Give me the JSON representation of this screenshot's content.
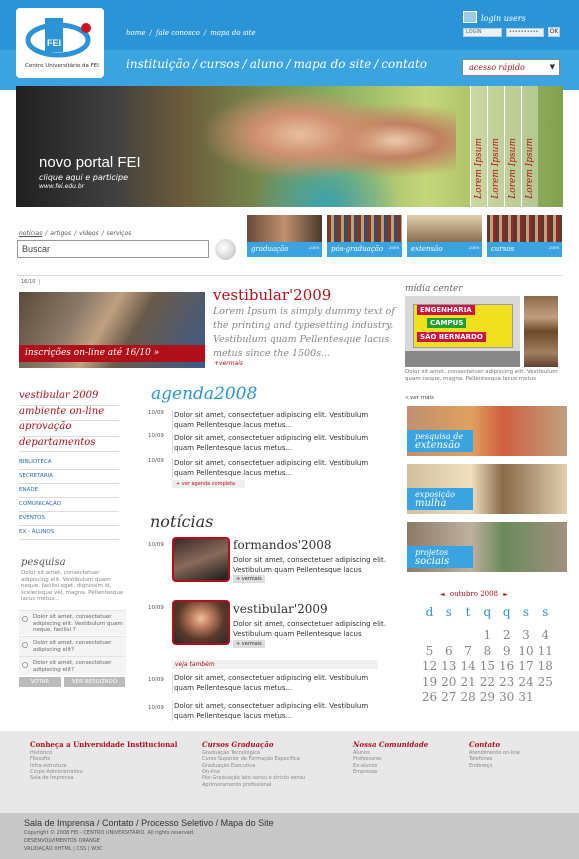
{
  "header": {
    "logo_text": "Centro Universitário da FEI",
    "logo_mark": "FEI",
    "topnav": [
      "home",
      "/",
      "fale conosco",
      "/",
      "mapa do site"
    ],
    "login_label": "login users",
    "login_field": "LOGIN",
    "password_field": "••••••••••",
    "ok_label": "OK",
    "mainnav": [
      "instituição",
      "/",
      "cursos",
      "/",
      "aluno",
      "/",
      "mapa do site",
      "/",
      "contato"
    ],
    "quick_access": "acesso rápido"
  },
  "hero": {
    "title": "novo portal FEI",
    "subtitle": "clique aqui e participe",
    "url": "www.fei.edu.br",
    "tabs": [
      "Lorem Ipsum",
      "Lorem Ipsum",
      "Lorem Ipsum",
      "Lorem Ipsum"
    ]
  },
  "subnav": [
    "notícias",
    "/",
    "artigos",
    "/",
    "vídeos",
    "/",
    "serviços"
  ],
  "search": {
    "placeholder": "Buscar"
  },
  "thumbs": [
    {
      "label": "graduação",
      "year": "2008"
    },
    {
      "label": "pós-graduação",
      "year": "2008"
    },
    {
      "label": "extensão",
      "year": "2008"
    },
    {
      "label": "cursos",
      "year": "2008"
    }
  ],
  "feature": {
    "date": "16/10",
    "bar": "inscrições on-line até 16/10 »",
    "title": "vestibular'2009",
    "text": "Lorem Ipsum is simply dummy text of the printing and typesetting industry. Vestibulum quam Pellentesque lacus metus since the 1500s...",
    "more": "+vermais"
  },
  "midia": {
    "title": "mídia center",
    "banner": [
      "ENGENHARIA",
      "CAMPUS",
      "SÃO BERNARDO"
    ],
    "text": "Dolor sit amet, consectetuer adipiscing elit. Vestibulum quam neque, magna. Pellentesque lacus metus",
    "more": "» ver mais"
  },
  "leftmenu": {
    "big": [
      "vestibular 2009",
      "ambiente on-line",
      "aprovação",
      "departamentos"
    ],
    "small": [
      "BIBLIOTECA",
      "SECRETARIA",
      "ENADE",
      "COMUNICAÇÃO",
      "EVENTOS",
      "EX - ALUNOS"
    ]
  },
  "poll": {
    "title": "pesquisa",
    "text": "Dolor sit amet, consectetuer adipiscing elit. Vestibulum quam neque, facilisi eget, dignissim id, scelerisque vel, magna. Pellentesque lacus metus...",
    "options": [
      "Dolor sit amet, consectetuer adipiscing elit. Vestibulum quam neque, facilisi ?",
      "Dolor sit amet, consectetuer adipiscing elit?",
      "Dolor sit amet, consectetuer adipiscing elit?"
    ],
    "vote": "VOTAR",
    "results": "VER RESULTADO"
  },
  "agenda": {
    "title": "agenda2008",
    "items": [
      {
        "date": "10/09",
        "text": "Dolor sit amet, consectetuer adipiscing elit. Vestibulum quam Pellentesque lacus metus..."
      },
      {
        "date": "10/09",
        "text": "Dolor sit amet, consectetuer adipiscing elit. Vestibulum quam Pellentesque lacus metus..."
      },
      {
        "date": "10/09",
        "text": "Dolor sit amet, consectetuer adipiscing elit. Vestibulum quam Pellentesque lacus metus..."
      }
    ],
    "link": "+ ver agenda completa"
  },
  "news": {
    "title": "notícias",
    "items": [
      {
        "date": "10/09",
        "title": "formandos'2008",
        "text": "Dolor sit amet, consectetuer adipiscing elit. Vestibulum quam Pellentesque lacus metus...",
        "more": "+ vermais"
      },
      {
        "date": "10/09",
        "title": "vestibular'2009",
        "text": "Dolor sit amet, consectetuer adipiscing elit. Vestibulum quam Pellentesque lacus metus...",
        "more": "+ vermais"
      }
    ],
    "veja": "veja também",
    "extra": [
      {
        "date": "10/09",
        "text": "Dolor sit amet, consectetuer adipiscing elit. Vestibulum quam Pellentesque lacus metus..."
      },
      {
        "date": "10/09",
        "text": "Dolor sit amet, consectetuer adipiscing elit. Vestibulum quam Pellentesque lacus metus..."
      }
    ]
  },
  "sideboxes": [
    {
      "label1": "pesquisa de",
      "label2": "extensão"
    },
    {
      "label1": "exposição",
      "label2": "mulha"
    },
    {
      "label1": "projetos",
      "label2": "sociais"
    }
  ],
  "calendar": {
    "month": "outubro 2008",
    "prev": "◄",
    "next": "►",
    "headers": [
      "d",
      "s",
      "t",
      "q",
      "q",
      "s",
      "s"
    ],
    "days": [
      "1",
      "2",
      "3",
      "4",
      "5",
      "6",
      "7",
      "8",
      "9",
      "10",
      "11",
      "12",
      "13",
      "14",
      "15",
      "16",
      "17",
      "18",
      "19",
      "20",
      "21",
      "22",
      "23",
      "24",
      "25",
      "26",
      "27",
      "28",
      "29",
      "30",
      "31"
    ]
  },
  "footer": {
    "cols": [
      {
        "title": "Conheça a Universidade Institucional",
        "items": [
          "Histórico",
          "Filosofia",
          "Infra-estrutura",
          "Corpo Administrativo",
          "Sala de Imprensa"
        ]
      },
      {
        "title": "Cursos Graduação",
        "items": [
          "Graduação Tecnológica",
          "Curso Superior de Formação Específica",
          "Graduação Executiva",
          "On-line",
          "Pós-Graduação lato sensu e stricto sensu",
          "Aprimoramento profissional"
        ]
      },
      {
        "title": "Nossa Comunidade",
        "items": [
          "Alunos",
          "Professores",
          "Ex-alunos",
          "Empresas"
        ]
      },
      {
        "title": "Contato",
        "items": [
          "Atendimento on-line",
          "Telefones",
          "Endereço"
        ]
      }
    ],
    "links": "Sala de Imprensa / Contato / Processo Seletivo / Mapa do Site",
    "copyright": "Copyright © 2008 FEI - CENTRO UNIVERSITÁRIO. All rights reserved.",
    "dev": "DESENVOLVIMENTOS ORANGE",
    "valid": "VALIDAÇÃO XHTML | CSS | W3C"
  },
  "colors": {
    "brand_blue": "#2a94d6",
    "accent_red": "#b0101a"
  }
}
